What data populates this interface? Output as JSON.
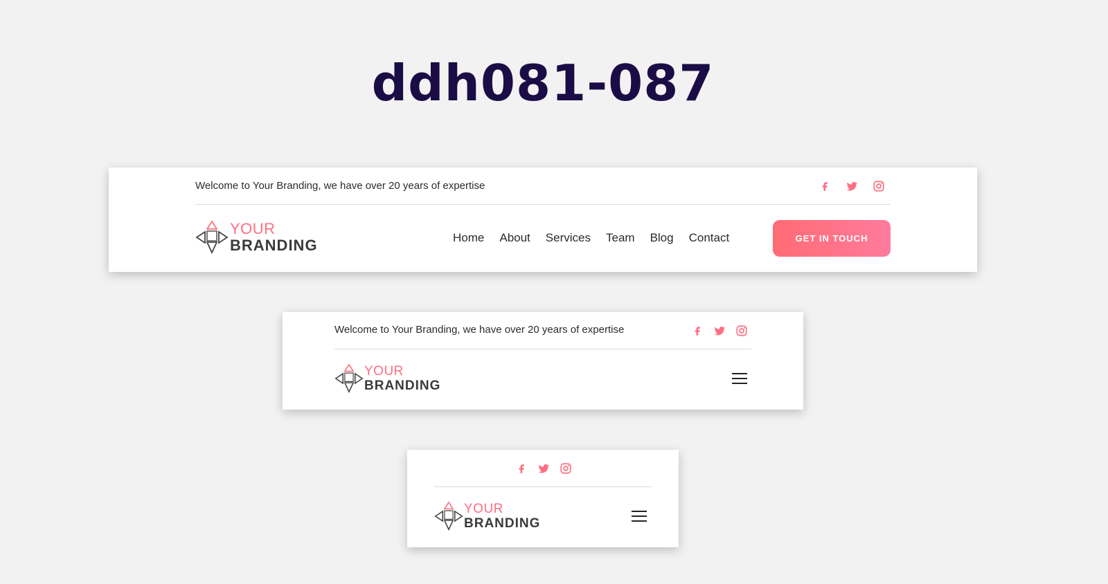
{
  "page": {
    "title": "ddh081-087"
  },
  "header": {
    "welcome_text": "Welcome to Your Branding, we have over 20 years of expertise",
    "social_icons": [
      "facebook-icon",
      "twitter-icon",
      "instagram-icon"
    ],
    "brand": {
      "line1": "YOUR",
      "line2": "BRANDING"
    },
    "nav": [
      "Home",
      "About",
      "Services",
      "Team",
      "Blog",
      "Contact"
    ],
    "cta_label": "GET IN TOUCH",
    "menu_icon": "hamburger-menu-icon"
  },
  "colors": {
    "accent": "#ff6f81",
    "title": "#1a0d45",
    "background": "#f2f2f2",
    "card": "#ffffff"
  }
}
